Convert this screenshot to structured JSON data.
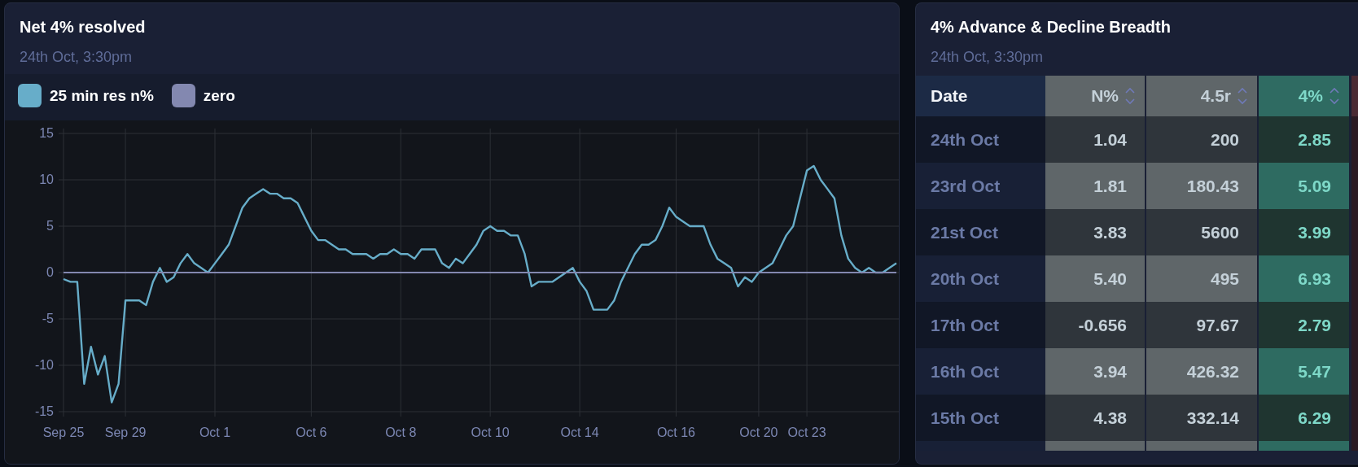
{
  "chart_panel": {
    "title": "Net 4% resolved",
    "subtitle": "24th Oct, 3:30pm",
    "chart_data": {
      "type": "line",
      "grid": true,
      "categories": [
        "Sep 25",
        null,
        null,
        null,
        null,
        null,
        null,
        null,
        null,
        "Sep 29",
        null,
        null,
        null,
        null,
        null,
        null,
        null,
        null,
        null,
        null,
        null,
        null,
        "Oct 1",
        null,
        null,
        null,
        null,
        null,
        null,
        null,
        null,
        null,
        null,
        null,
        null,
        null,
        "Oct 6",
        null,
        null,
        null,
        null,
        null,
        null,
        null,
        null,
        null,
        null,
        null,
        null,
        "Oct 8",
        null,
        null,
        null,
        null,
        null,
        null,
        null,
        null,
        null,
        null,
        null,
        null,
        "Oct 10",
        null,
        null,
        null,
        null,
        null,
        null,
        null,
        null,
        null,
        null,
        null,
        null,
        "Oct 14",
        null,
        null,
        null,
        null,
        null,
        null,
        null,
        null,
        null,
        null,
        null,
        null,
        null,
        "Oct 16",
        null,
        null,
        null,
        null,
        null,
        null,
        null,
        null,
        null,
        null,
        null,
        "Oct 20",
        null,
        null,
        null,
        null,
        null,
        null,
        "Oct 23",
        null,
        null,
        null,
        null,
        null,
        null,
        null,
        null,
        null,
        null,
        null,
        null,
        null
      ],
      "ylim": [
        -15,
        15
      ],
      "yticks": [
        -15,
        -10,
        -5,
        0,
        5,
        10,
        15
      ],
      "series": [
        {
          "name": "25 min res n%",
          "color": "#67adc9",
          "values": [
            -0.7,
            -1,
            -1,
            -12,
            -8,
            -11,
            -9,
            -14,
            -12,
            -3,
            -3,
            -3,
            -3.5,
            -1,
            0.5,
            -1,
            -0.5,
            1,
            2,
            1,
            0.5,
            0,
            1,
            2,
            3,
            5,
            7,
            8,
            8.5,
            9,
            8.5,
            8.5,
            8,
            8,
            7.5,
            6,
            4.5,
            3.5,
            3.5,
            3,
            2.5,
            2.5,
            2,
            2,
            2,
            1.5,
            2,
            2,
            2.5,
            2,
            2,
            1.5,
            2.5,
            2.5,
            2.5,
            1,
            0.5,
            1.5,
            1,
            2,
            3,
            4.5,
            5,
            4.5,
            4.5,
            4,
            4,
            2,
            -1.5,
            -1,
            -1,
            -1,
            -0.5,
            0,
            0.5,
            -1,
            -2,
            -4,
            -4,
            -4,
            -3,
            -1,
            0.5,
            2,
            3,
            3,
            3.5,
            5,
            7,
            6,
            5.5,
            5,
            5,
            5,
            3,
            1.5,
            1,
            0.5,
            -1.5,
            -0.5,
            -1,
            0,
            0.5,
            1,
            2.5,
            4,
            5,
            8,
            11,
            11.5,
            10,
            9,
            8,
            4,
            1.5,
            0.5,
            0,
            0.5,
            0,
            0,
            0.5,
            1
          ]
        },
        {
          "name": "zero",
          "color": "#8388b0",
          "values": [
            0,
            0,
            0,
            0,
            0,
            0,
            0,
            0,
            0,
            0,
            0,
            0,
            0,
            0,
            0,
            0,
            0,
            0,
            0,
            0,
            0,
            0,
            0,
            0,
            0,
            0,
            0,
            0,
            0,
            0,
            0,
            0,
            0,
            0,
            0,
            0,
            0,
            0,
            0,
            0,
            0,
            0,
            0,
            0,
            0,
            0,
            0,
            0,
            0,
            0,
            0,
            0,
            0,
            0,
            0,
            0,
            0,
            0,
            0,
            0,
            0,
            0,
            0,
            0,
            0,
            0,
            0,
            0,
            0,
            0,
            0,
            0,
            0,
            0,
            0,
            0,
            0,
            0,
            0,
            0,
            0,
            0,
            0,
            0,
            0,
            0,
            0,
            0,
            0,
            0,
            0,
            0,
            0,
            0,
            0,
            0,
            0,
            0,
            0,
            0,
            0,
            0,
            0,
            0,
            0,
            0,
            0,
            0,
            0,
            0,
            0,
            0,
            0,
            0,
            0,
            0,
            0,
            0,
            0,
            0,
            0,
            0
          ]
        }
      ]
    }
  },
  "table_panel": {
    "title": "4% Advance & Decline Breadth",
    "subtitle": "24th Oct, 3:30pm",
    "columns": [
      {
        "label": "Date",
        "kind": "date"
      },
      {
        "label": "N%",
        "kind": "number"
      },
      {
        "label": "4.5r",
        "kind": "number"
      },
      {
        "label": "4%",
        "kind": "highlight"
      }
    ],
    "rows": [
      [
        "24th Oct",
        "1.04",
        "200",
        "2.85"
      ],
      [
        "23rd Oct",
        "1.81",
        "180.43",
        "5.09"
      ],
      [
        "21st Oct",
        "3.83",
        "5600",
        "3.99"
      ],
      [
        "20th Oct",
        "5.40",
        "495",
        "6.93"
      ],
      [
        "17th Oct",
        "-0.656",
        "97.67",
        "2.79"
      ],
      [
        "16th Oct",
        "3.94",
        "426.32",
        "5.47"
      ],
      [
        "15th Oct",
        "4.38",
        "332.14",
        "6.29"
      ]
    ]
  }
}
